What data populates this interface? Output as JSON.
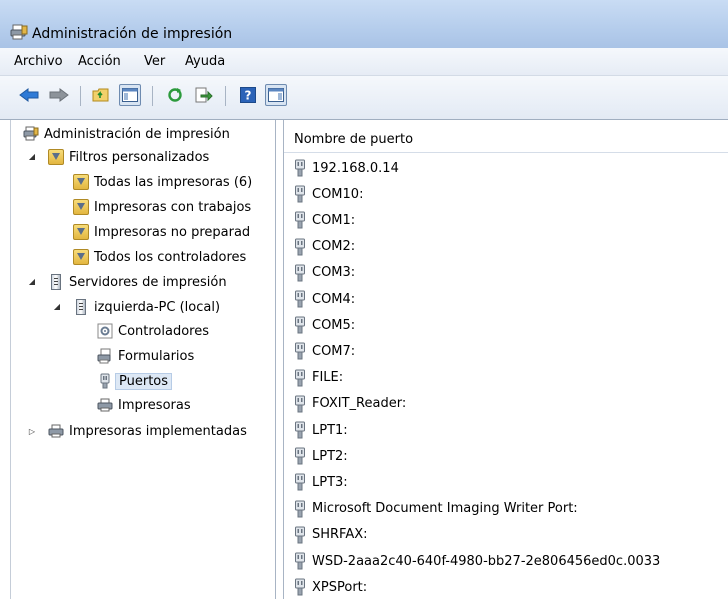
{
  "window": {
    "title": "Administración de impresión"
  },
  "menu": [
    "Archivo",
    "Acción",
    "Ver",
    "Ayuda"
  ],
  "toolbar": {
    "buttons": [
      "back-icon",
      "forward-icon",
      "up-folder-icon",
      "show-hide-console-tree-icon",
      "refresh-icon",
      "export-list-icon",
      "help-icon",
      "show-hide-action-pane-icon"
    ]
  },
  "tree": {
    "root": "Administración de impresión",
    "filters": "Filtros personalizados",
    "filter_items": [
      "Todas las impresoras (6)",
      "Impresoras con trabajos",
      "Impresoras no preparad",
      "Todos los controladores"
    ],
    "servers": "Servidores de impresión",
    "server": "izquierda-PC (local)",
    "server_items": [
      "Controladores",
      "Formularios",
      "Puertos",
      "Impresoras"
    ],
    "deployed": "Impresoras implementadas"
  },
  "list": {
    "column": "Nombre de puerto",
    "ports": [
      "192.168.0.14",
      "COM10:",
      "COM1:",
      "COM2:",
      "COM3:",
      "COM4:",
      "COM5:",
      "COM7:",
      "FILE:",
      "FOXIT_Reader:",
      "LPT1:",
      "LPT2:",
      "LPT3:",
      "Microsoft Document Imaging Writer Port:",
      "SHRFAX:",
      "WSD-2aaa2c40-640f-4980-bb27-2e806456ed0c.0033",
      "XPSPort:"
    ]
  }
}
